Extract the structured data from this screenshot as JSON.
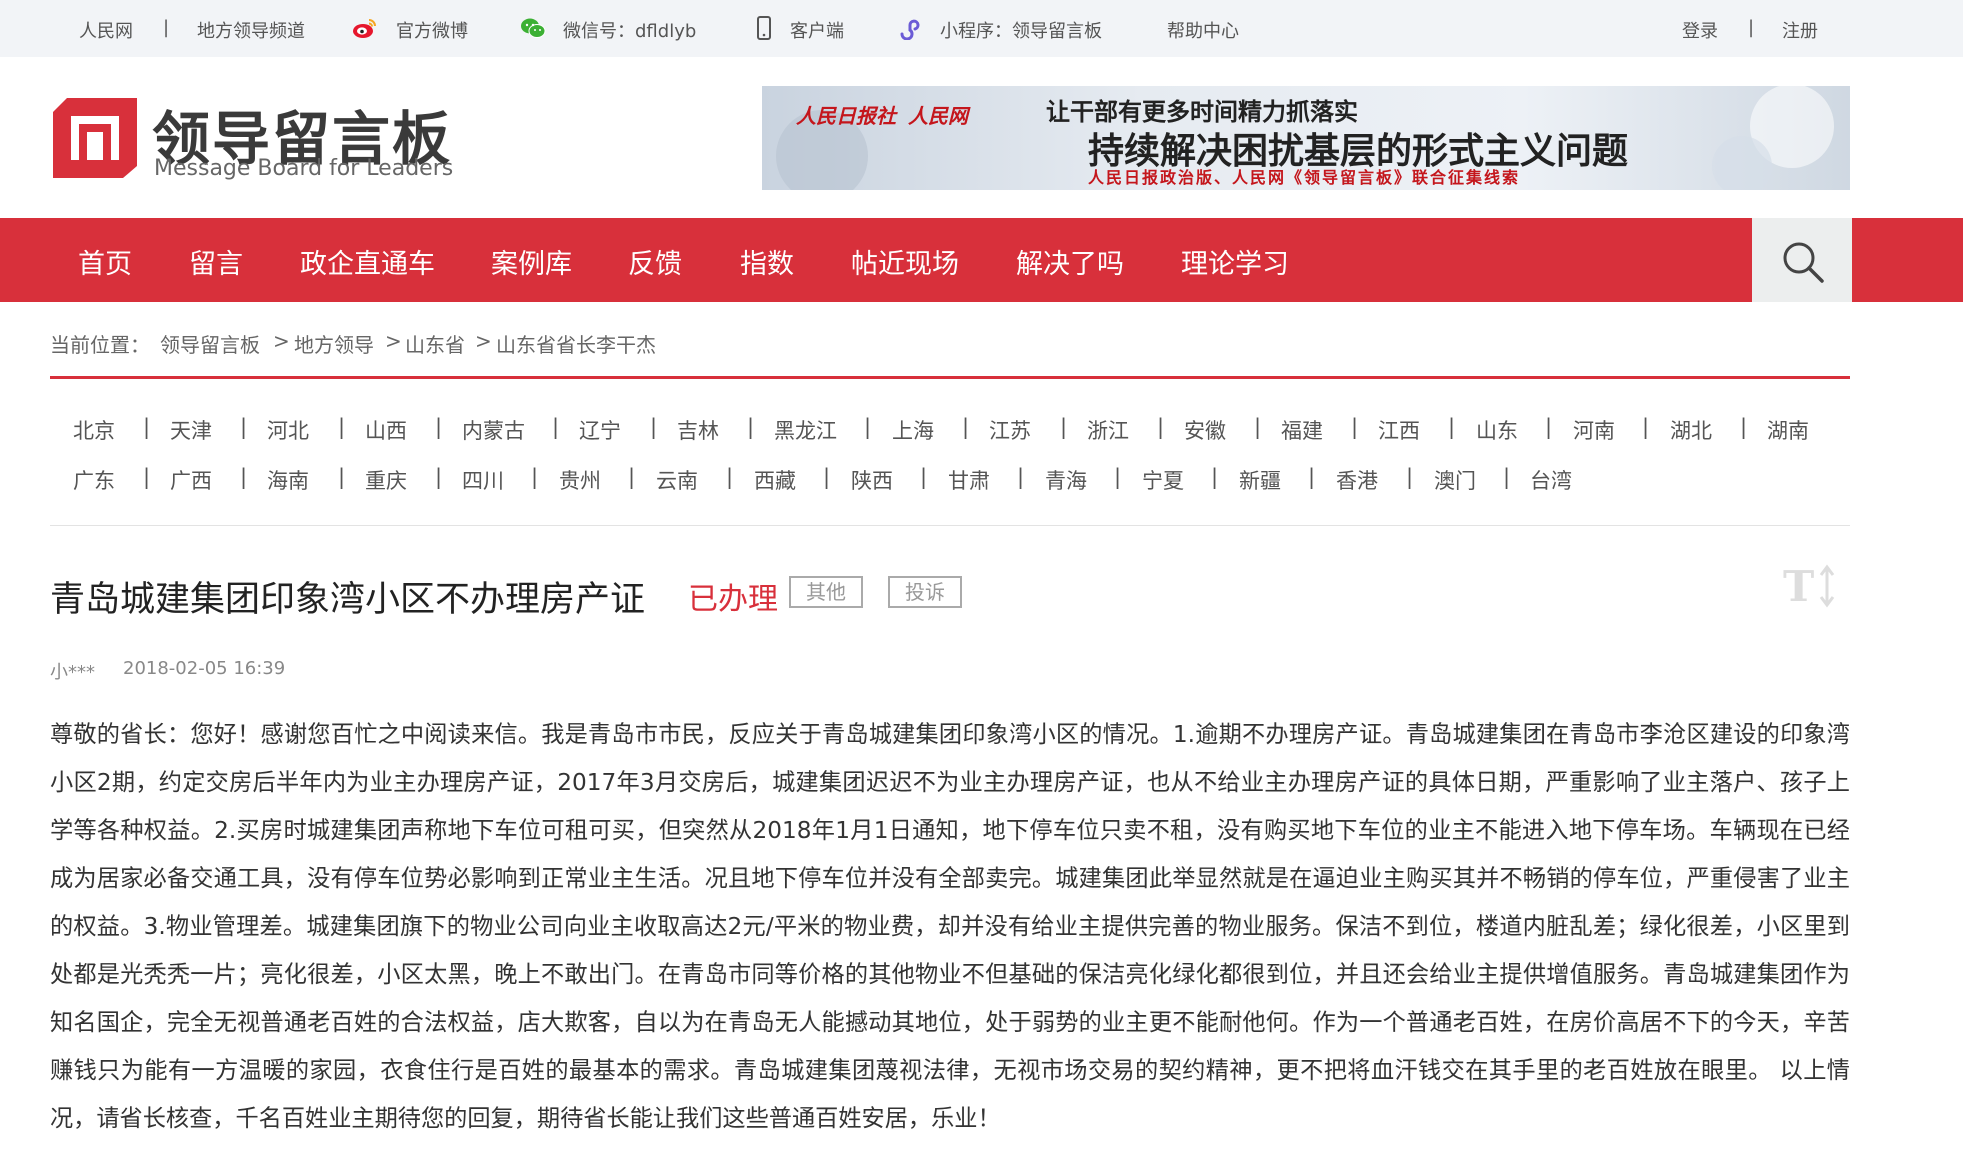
{
  "topbar": {
    "renminwang": "人民网",
    "sep1": "|",
    "local_channel": "地方领导频道",
    "weibo": "官方微博",
    "wechat": "微信号：dfldlyb",
    "client": "客户端",
    "miniprogram": "小程序：领导留言板",
    "help": "帮助中心",
    "login": "登录",
    "sep2": "|",
    "register": "注册"
  },
  "logo": {
    "cn": "领导留言板",
    "en": "Message Board for Leaders"
  },
  "banner": {
    "people_daily": "人民日报社",
    "people_net": "人民网",
    "line1": "让干部有更多时间精力抓落实",
    "line2": "持续解决困扰基层的形式主义问题",
    "line3": "人民日报政治版、人民网《领导留言板》联合征集线索"
  },
  "nav": {
    "items": [
      "首页",
      "留言",
      "政企直通车",
      "案例库",
      "反馈",
      "指数",
      "帖近现场",
      "解决了吗",
      "理论学习"
    ]
  },
  "breadcrumb": {
    "prefix": "当前位置：",
    "c1": "领导留言板",
    "gt1": ">",
    "c2": "地方领导",
    "gt2": ">",
    "c3": "山东省",
    "gt3": ">",
    "c4": "山东省省长李干杰"
  },
  "provinces": {
    "row1": [
      "北京",
      "天津",
      "河北",
      "山西",
      "内蒙古",
      "辽宁",
      "吉林",
      "黑龙江",
      "上海",
      "江苏",
      "浙江",
      "安徽",
      "福建",
      "江西",
      "山东",
      "河南",
      "湖北",
      "湖南"
    ],
    "row2": [
      "广东",
      "广西",
      "海南",
      "重庆",
      "四川",
      "贵州",
      "云南",
      "西藏",
      "陕西",
      "甘肃",
      "青海",
      "宁夏",
      "新疆",
      "香港",
      "澳门",
      "台湾"
    ],
    "separator": "|"
  },
  "message": {
    "title": "青岛城建集团印象湾小区不办理房产证",
    "status": "已办理",
    "tag1": "其他",
    "tag2": "投诉",
    "author": "小***",
    "date": "2018-02-05 16:39",
    "body": "尊敬的省长：您好！感谢您百忙之中阅读来信。我是青岛市市民，反应关于青岛城建集团印象湾小区的情况。1.逾期不办理房产证。青岛城建集团在青岛市李沧区建设的印象湾小区2期，约定交房后半年内为业主办理房产证，2017年3月交房后，城建集团迟迟不为业主办理房产证，也从不给业主办理房产证的具体日期，严重影响了业主落户、孩子上学等各种权益。2.买房时城建集团声称地下车位可租可买，但突然从2018年1月1日通知，地下停车位只卖不租，没有购买地下车位的业主不能进入地下停车场。车辆现在已经成为居家必备交通工具，没有停车位势必影响到正常业主生活。况且地下停车位并没有全部卖完。城建集团此举显然就是在逼迫业主购买其并不畅销的停车位，严重侵害了业主的权益。3.物业管理差。城建集团旗下的物业公司向业主收取高达2元/平米的物业费，却并没有给业主提供完善的物业服务。保洁不到位，楼道内脏乱差；绿化很差，小区里到处都是光秃秃一片；亮化很差，小区太黑，晚上不敢出门。在青岛市同等价格的其他物业不但基础的保洁亮化绿化都很到位，并且还会给业主提供增值服务。青岛城建集团作为知名国企，完全无视普通老百姓的合法权益，店大欺客，自以为在青岛无人能撼动其地位，处于弱势的业主更不能耐他何。作为一个普通老百姓，在房价高居不下的今天，辛苦赚钱只为能有一方温暖的家园，衣食住行是百姓的最基本的需求。青岛城建集团蔑视法律，无视市场交易的契约精神，更不把将血汗钱交在其手里的老百姓放在眼里。 以上情况，请省长核查，千名百姓业主期待您的回复，期待省长能让我们这些普通百姓安居，乐业！"
  },
  "colors": {
    "brand_red": "#d8303b",
    "topbar_bg": "#f2f4f7"
  },
  "icons": [
    "weibo-icon",
    "wechat-icon",
    "phone-icon",
    "miniprogram-icon",
    "search-icon",
    "font-size-icon"
  ]
}
